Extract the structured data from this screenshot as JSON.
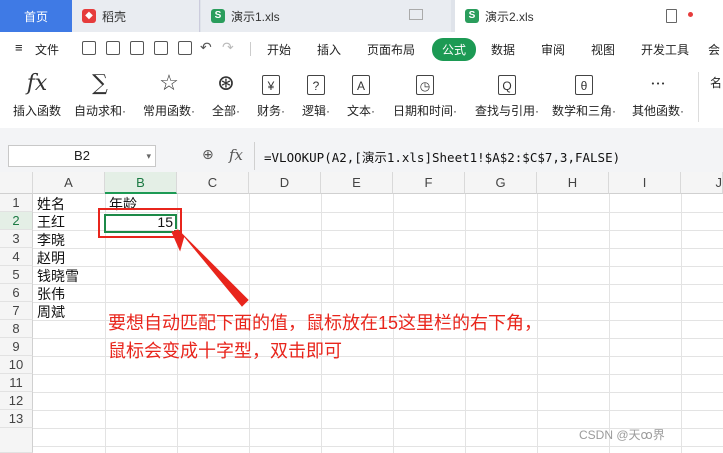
{
  "tabs": {
    "home": "首页",
    "daoke": "稻壳",
    "file1": "演示1.xls",
    "file2": "演示2.xls"
  },
  "menu": {
    "file": "文件",
    "items": [
      "开始",
      "插入",
      "页面布局",
      "公式",
      "数据",
      "审阅",
      "视图",
      "开发工具",
      "会"
    ]
  },
  "ribbon": [
    {
      "glyph": "fx",
      "label": "插入函数"
    },
    {
      "glyph": "∑",
      "label": "自动求和·"
    },
    {
      "glyph": "☆",
      "label": "常用函数·"
    },
    {
      "glyph": "⊛",
      "label": "全部·"
    },
    {
      "glyph": "¥",
      "label": "财务·"
    },
    {
      "glyph": "?",
      "label": "逻辑·"
    },
    {
      "glyph": "A",
      "label": "文本·"
    },
    {
      "glyph": "◷",
      "label": "日期和时间·"
    },
    {
      "glyph": "Q",
      "label": "查找与引用·"
    },
    {
      "glyph": "θ",
      "label": "数学和三角·"
    },
    {
      "glyph": "···",
      "label": "其他函数·"
    },
    {
      "glyph": "",
      "label": "名"
    }
  ],
  "formula_bar": {
    "name_box": "B2",
    "fx": "fx",
    "formula": "=VLOOKUP(A2,[演示1.xls]Sheet1!$A$2:$C$7,3,FALSE)"
  },
  "columns": [
    "A",
    "B",
    "C",
    "D",
    "E",
    "F",
    "G",
    "H",
    "I",
    "J"
  ],
  "rows": [
    "1",
    "2",
    "3",
    "4",
    "5",
    "6",
    "7",
    "8",
    "9",
    "10",
    "11",
    "12",
    "13"
  ],
  "cells": {
    "a1": "姓名",
    "b1": "年龄",
    "a2": "王红",
    "b2": "15",
    "a3": "李晓",
    "a4": "赵明",
    "a5": "钱晓雪",
    "a6": "张伟",
    "a7": "周斌"
  },
  "annotation": {
    "line1": "要想自动匹配下面的值，鼠标放在15这里栏的右下角，",
    "line2": "鼠标会变成十字型，双击即可"
  },
  "watermark": "CSDN @天ꝏ界",
  "colors": {
    "accent_green": "#1c9a54",
    "annotation_red": "#e8251c",
    "home_tab": "#3f7ae5"
  }
}
